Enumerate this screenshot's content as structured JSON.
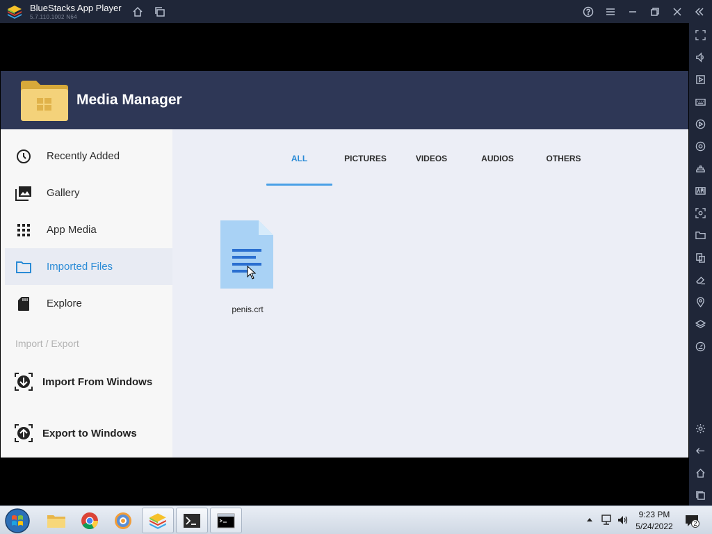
{
  "window": {
    "title": "BlueStacks App Player",
    "version": "5.7.110.1002  N64"
  },
  "app": {
    "name": "Media Manager"
  },
  "nav": {
    "items": [
      {
        "label": "Recently Added",
        "icon": "clock-icon"
      },
      {
        "label": "Gallery",
        "icon": "gallery-icon"
      },
      {
        "label": "App Media",
        "icon": "grid-icon"
      },
      {
        "label": "Imported Files",
        "icon": "folder-icon",
        "active": true
      },
      {
        "label": "Explore",
        "icon": "sd-card-icon"
      }
    ],
    "section_label": "Import / Export",
    "import_label": "Import From Windows",
    "export_label": "Export to Windows"
  },
  "tabs": [
    {
      "label": "ALL",
      "active": true
    },
    {
      "label": "PICTURES"
    },
    {
      "label": "VIDEOS"
    },
    {
      "label": "AUDIOS"
    },
    {
      "label": "OTHERS"
    }
  ],
  "files": [
    {
      "name": "penis.crt",
      "icon": "document-icon"
    }
  ],
  "taskbar": {
    "time": "9:23 PM",
    "date": "5/24/2022",
    "notification_count": "2"
  },
  "colors": {
    "titlebar": "#1f2638",
    "header": "#2e3756",
    "accent": "#2a8bd6",
    "file_icon": "#a9d2f5"
  }
}
